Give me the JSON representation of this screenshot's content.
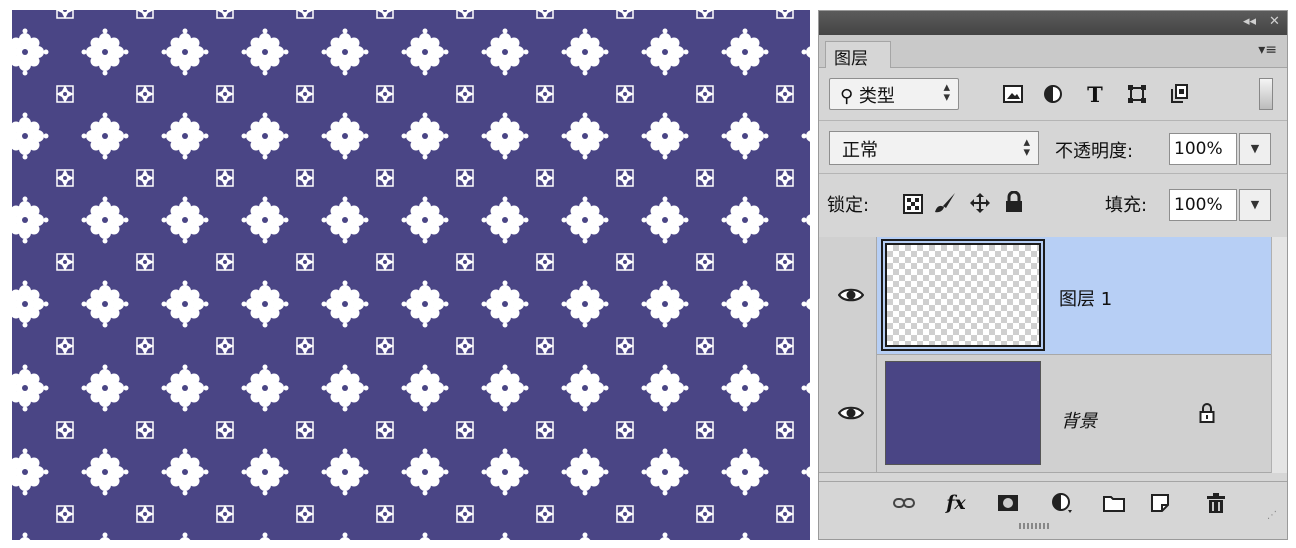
{
  "panel": {
    "tab_label": "图层",
    "filter": {
      "label": "类型",
      "icons": [
        "image-filter-icon",
        "adjustment-filter-icon",
        "type-filter-icon",
        "shape-filter-icon",
        "smart-object-filter-icon"
      ],
      "type_icon_glyph": "T"
    },
    "blend_mode": "正常",
    "opacity_label": "不透明度:",
    "opacity_value": "100%",
    "lock_label": "锁定:",
    "fill_label": "填充:",
    "fill_value": "100%",
    "layers": [
      {
        "name": "图层 1",
        "selected": true,
        "thumb": "transparent"
      },
      {
        "name": "背景",
        "selected": false,
        "thumb": "#4a4585",
        "locked": true
      }
    ],
    "bottom_icons": [
      "link-icon",
      "fx-icon",
      "mask-icon",
      "adjustment-icon",
      "folder-icon",
      "new-layer-icon",
      "trash-icon"
    ],
    "fx_label": "fx"
  },
  "canvas": {
    "background": "#4a4585",
    "motif_color": "#ffffff"
  }
}
